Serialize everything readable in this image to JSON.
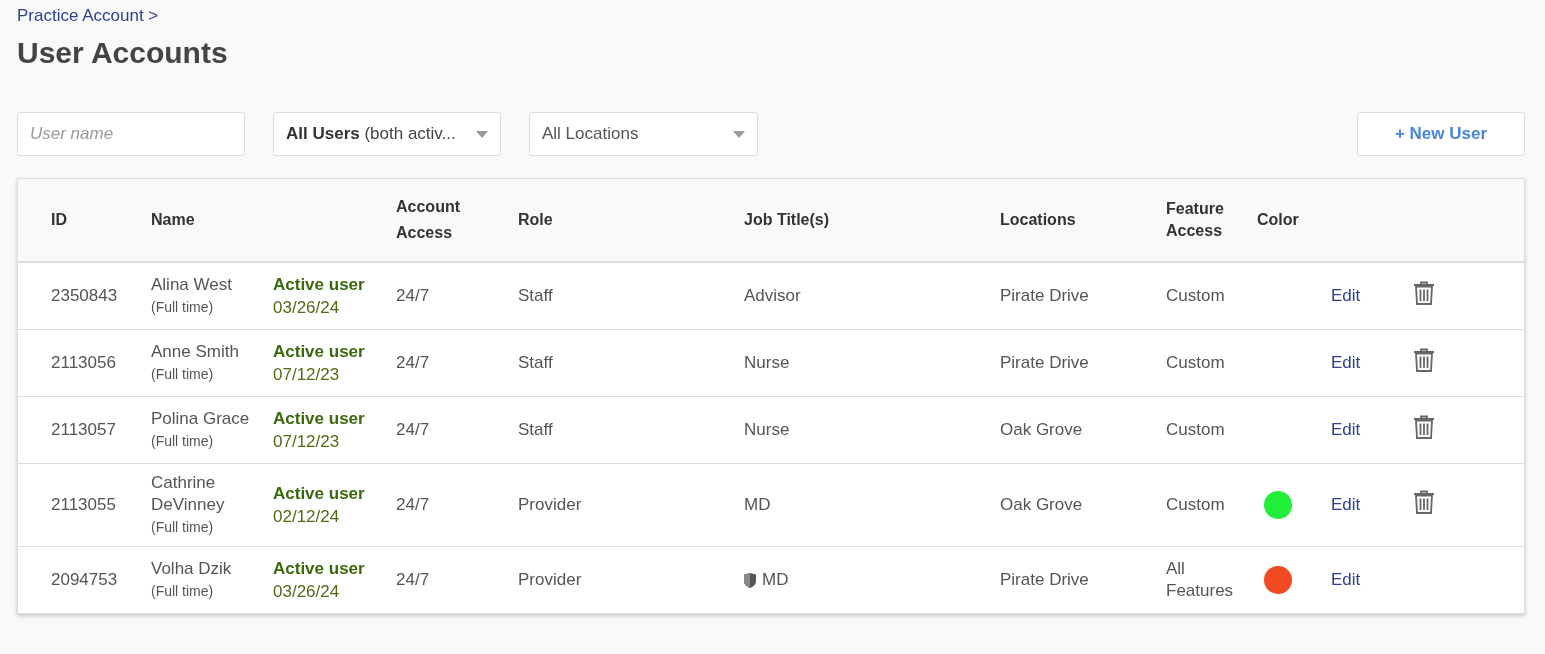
{
  "breadcrumb": "Practice Account >",
  "title": "User Accounts",
  "filters": {
    "search": {
      "placeholder": "User name"
    },
    "status_select": {
      "value": "**All Users** (both activ..."
    },
    "location_select": {
      "value": "All Locations"
    }
  },
  "new_user_button": "+ New User",
  "table": {
    "columns": [
      "ID",
      "Name",
      "Account Access",
      "Role",
      "Job Title(s)",
      "Locations",
      "Feature Access",
      "Color"
    ],
    "rows": [
      {
        "id": "2350843",
        "name": "Alina West",
        "employment": "(Full time)",
        "status": "Active user",
        "date": "03/26/24",
        "access": "24/7",
        "role": "Staff",
        "job_title": "Advisor",
        "shield": false,
        "location": "Pirate Drive",
        "features": "Custom",
        "color": null,
        "edit": "Edit",
        "deletable": true
      },
      {
        "id": "2113056",
        "name": "Anne Smith",
        "employment": "(Full time)",
        "status": "Active user",
        "date": "07/12/23",
        "access": "24/7",
        "role": "Staff",
        "job_title": "Nurse",
        "shield": false,
        "location": "Pirate Drive",
        "features": "Custom",
        "color": null,
        "edit": "Edit",
        "deletable": true
      },
      {
        "id": "2113057",
        "name": "Polina Grace",
        "employment": "(Full time)",
        "status": "Active user",
        "date": "07/12/23",
        "access": "24/7",
        "role": "Staff",
        "job_title": "Nurse",
        "shield": false,
        "location": "Oak Grove",
        "features": "Custom",
        "color": null,
        "edit": "Edit",
        "deletable": true
      },
      {
        "id": "2113055",
        "name": "Cathrine DeVinney",
        "employment": "(Full time)",
        "status": "Active user",
        "date": "02/12/24",
        "access": "24/7",
        "role": "Provider",
        "job_title": "MD",
        "shield": false,
        "location": "Oak Grove",
        "features": "Custom",
        "color": "#22ee3a",
        "edit": "Edit",
        "deletable": true
      },
      {
        "id": "2094753",
        "name": "Volha Dzik",
        "employment": "(Full time)",
        "status": "Active user",
        "date": "03/26/24",
        "access": "24/7",
        "role": "Provider",
        "job_title": "MD",
        "shield": true,
        "location": "Pirate Drive",
        "features": "All Features",
        "color": "#f04a22",
        "edit": "Edit",
        "deletable": false
      }
    ]
  }
}
